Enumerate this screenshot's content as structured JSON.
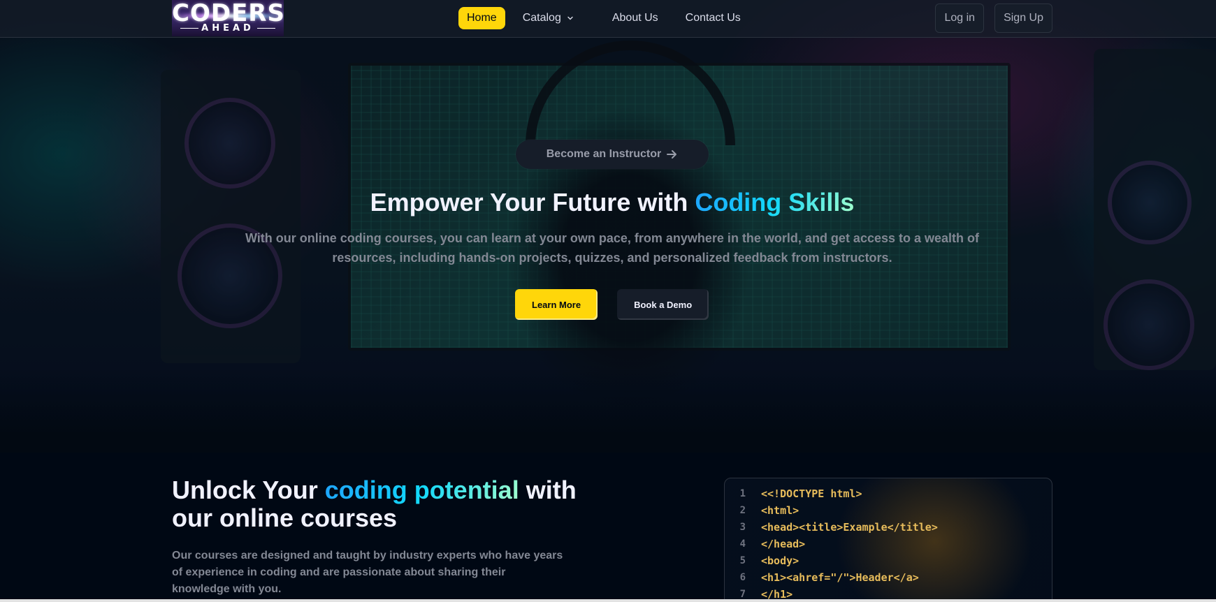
{
  "navbar": {
    "logo_line1": "CODERS",
    "logo_line2": "AHEAD",
    "links": [
      {
        "label": "Home",
        "active": true
      },
      {
        "label": "Catalog",
        "dropdown": true
      },
      {
        "label": "About Us"
      },
      {
        "label": "Contact Us"
      }
    ],
    "login_label": "Log in",
    "signup_label": "Sign Up"
  },
  "hero": {
    "instructor_label": "Become an Instructor",
    "title_prefix": "Empower Your Future with ",
    "title_highlight": "Coding Skills",
    "subtitle": "With our online coding courses, you can learn at your own pace, from anywhere in the world, and get access to a wealth of resources, including hands-on projects, quizzes, and personalized feedback from instructors.",
    "learn_more_label": "Learn More",
    "book_demo_label": "Book a Demo"
  },
  "section2": {
    "title_prefix": "Unlock Your ",
    "title_highlight": "coding potential",
    "title_suffix": " with our online courses",
    "description": "Our courses are designed and taught by industry experts who have years of experience in coding and are passionate about sharing their knowledge with you.",
    "code_lines": [
      {
        "num": "1",
        "text": "<<!DOCTYPE html>"
      },
      {
        "num": "2",
        "text": "<html>"
      },
      {
        "num": "3",
        "text": "<head><title>Example</title>"
      },
      {
        "num": "4",
        "text": "</head>"
      },
      {
        "num": "5",
        "text": "<body>"
      },
      {
        "num": "6",
        "text": "<h1><ahref=\"/\">Header</a>"
      },
      {
        "num": "7",
        "text": "</h1>"
      }
    ]
  },
  "colors": {
    "accent_yellow": "#ffd60a",
    "bg_dark": "#000814",
    "nav_bg": "#161d29",
    "gradient_blue": "#1fa2ff",
    "gradient_cyan": "#12d8fa",
    "code_color": "#e7bc5b"
  }
}
